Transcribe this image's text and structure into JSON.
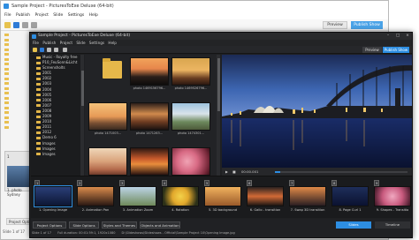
{
  "bg_window": {
    "title": "Sample Project - PicturesToExe Deluxe (64-bit)",
    "menu": [
      "File",
      "Publish",
      "Project",
      "Slide",
      "Settings",
      "Help"
    ],
    "preview_label": "Preview",
    "publish_label": "Publish Show",
    "slide_label": "1",
    "slide_caption": "1. photo Sydney",
    "project_options": "Project Options",
    "status": "Slide 1 of 17"
  },
  "fg_window": {
    "title": "Sample Project - PicturesToExe Deluxe (64-bit)",
    "menu": [
      "File",
      "Publish",
      "Project",
      "Slide",
      "Settings",
      "Help"
    ],
    "preview_label": "Preview",
    "publish_label": "Publish Show",
    "tree": [
      "Music - Royalty free",
      "P10_FeuSonn&Licht",
      "Screensholts",
      "2001",
      "2002",
      "2003",
      "2004",
      "2005",
      "2006",
      "2007",
      "2008",
      "2009",
      "2010",
      "2011",
      "2012",
      "Demo 6",
      "Images",
      "Images",
      "Images"
    ],
    "grid": [
      {
        "caption": "",
        "kind": "folder"
      },
      {
        "caption": "photo 1469156796...",
        "kind": "img1"
      },
      {
        "caption": "photo 1469526796...",
        "kind": "img2"
      },
      {
        "caption": "photo 1471003...",
        "kind": "img3"
      },
      {
        "caption": "photo 1471263...",
        "kind": "img4"
      },
      {
        "caption": "photo 1474301...",
        "kind": "img5"
      },
      {
        "caption": "photo 1482343...",
        "kind": "img6"
      },
      {
        "caption": "photo 1486520...",
        "kind": "img7"
      },
      {
        "caption": "photo 1490127...",
        "kind": "img8"
      }
    ],
    "transport": {
      "time": "00:00.001",
      "total": "01:04.250"
    },
    "slides": [
      {
        "num": "1",
        "caption": "1. Opening Image"
      },
      {
        "num": "2",
        "caption": "2. Animation Pan"
      },
      {
        "num": "3",
        "caption": "3. Animation Zoom"
      },
      {
        "num": "4",
        "caption": "4. Rotation"
      },
      {
        "num": "5",
        "caption": "5. 3D background"
      },
      {
        "num": "6",
        "caption": "6. Gallo - transition"
      },
      {
        "num": "7",
        "caption": "7. Swap 3D transition"
      },
      {
        "num": "8",
        "caption": "8. Page Curl 1"
      },
      {
        "num": "9",
        "caption": "9. Shapes - Transitio"
      }
    ],
    "buttons": [
      "Project Options",
      "Slide Options",
      "Styles and Themes",
      "Objects and Animation"
    ],
    "slides_tab": "Slides",
    "timeline_tab": "Timeline",
    "status": [
      "Slide 1 of 17",
      "Full duration: 00:01:59:1, 1920x1080",
      "D:\\Slideshows\\Slideshows - Official\\Sample Project 10\\Opening Image.jpg"
    ]
  }
}
